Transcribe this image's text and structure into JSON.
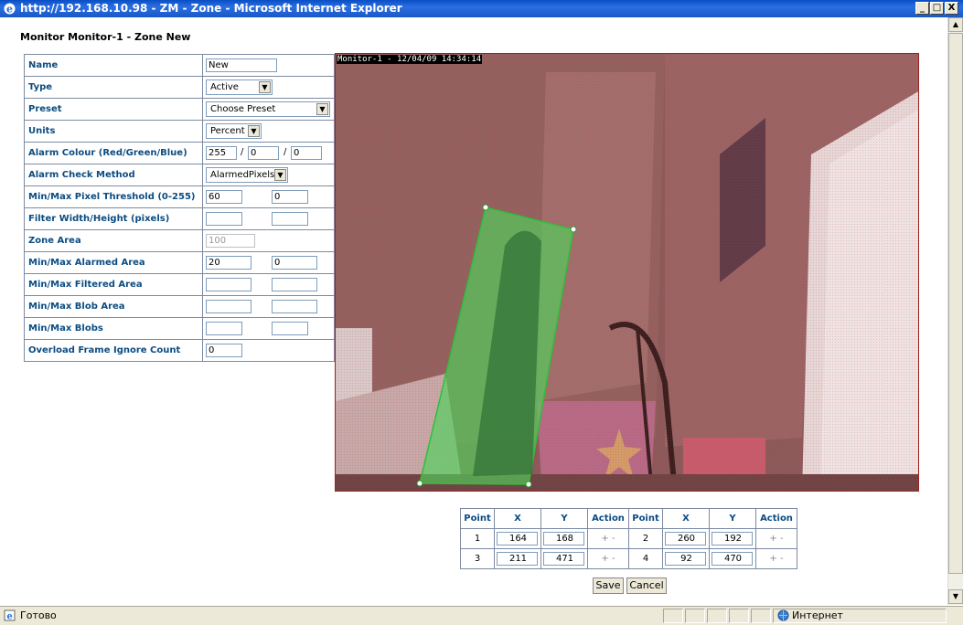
{
  "window": {
    "title": "http://192.168.10.98 - ZM - Zone - Microsoft Internet Explorer",
    "controls": {
      "minimize": "_",
      "maximize": "□",
      "close": "X"
    }
  },
  "heading": "Monitor Monitor-1 - Zone New",
  "form": {
    "name_label": "Name",
    "name_value": "New",
    "type_label": "Type",
    "type_value": "Active",
    "preset_label": "Preset",
    "preset_value": "Choose Preset",
    "units_label": "Units",
    "units_value": "Percent",
    "alarm_colour_label": "Alarm Colour (Red/Green/Blue)",
    "alarm_r": "255",
    "alarm_g": "0",
    "alarm_b": "0",
    "slash": "/",
    "check_method_label": "Alarm Check Method",
    "check_method_value": "AlarmedPixels",
    "pixel_threshold_label": "Min/Max Pixel Threshold (0-255)",
    "pixel_min": "60",
    "pixel_max": "0",
    "filter_label": "Filter Width/Height (pixels)",
    "filter_w": "",
    "filter_h": "",
    "zone_area_label": "Zone Area",
    "zone_area_value": "100",
    "alarmed_area_label": "Min/Max Alarmed Area",
    "alarmed_min": "20",
    "alarmed_max": "0",
    "filtered_area_label": "Min/Max Filtered Area",
    "filtered_min": "",
    "filtered_max": "",
    "blob_area_label": "Min/Max Blob Area",
    "blob_area_min": "",
    "blob_area_max": "",
    "blobs_label": "Min/Max Blobs",
    "blobs_min": "",
    "blobs_max": "",
    "overload_label": "Overload Frame Ignore Count",
    "overload_value": "0"
  },
  "camera": {
    "stamp": "Monitor-1 - 12/04/09 14:34:14",
    "tint_color": "#b04a4a",
    "zone_color": "#4fd35a"
  },
  "points_table": {
    "headers": [
      "Point",
      "X",
      "Y",
      "Action"
    ],
    "rows": [
      {
        "point": "1",
        "x": "164",
        "y": "168",
        "action": "+ -"
      },
      {
        "point": "2",
        "x": "260",
        "y": "192",
        "action": "+ -"
      },
      {
        "point": "3",
        "x": "211",
        "y": "471",
        "action": "+ -"
      },
      {
        "point": "4",
        "x": "92",
        "y": "470",
        "action": "+ -"
      }
    ]
  },
  "buttons": {
    "save": "Save",
    "cancel": "Cancel"
  },
  "statusbar": {
    "status": "Готово",
    "zone": "Интернет"
  }
}
